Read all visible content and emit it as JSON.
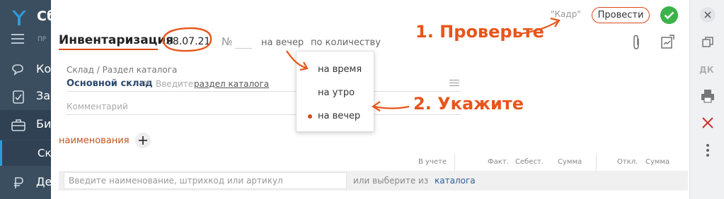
{
  "sidebar": {
    "logo_text": "Сб",
    "menu_label": "ПР",
    "items": [
      {
        "icon": "contacts-icon",
        "label": "Ко"
      },
      {
        "icon": "tasks-icon",
        "label": "За"
      },
      {
        "icon": "business-icon",
        "label": "Би"
      },
      {
        "icon": "money-icon",
        "label": "Де"
      }
    ],
    "sub_item": "Ск"
  },
  "header": {
    "title": "Инвентаризация",
    "date": "08.07.21",
    "number_label": "№",
    "time_value": "на вечер",
    "mode_value": "по количеству",
    "kadr": "\"Кадр\"",
    "provesti_label": "Провести"
  },
  "form": {
    "sklad_label": "Склад / Раздел каталога",
    "sklad_value": "Основной склад",
    "razdel_placeholder": "Введите",
    "razdel_link": "раздел каталога",
    "comment_placeholder": "Комментарий"
  },
  "tabs": {
    "naimenovaniya": "наименования"
  },
  "table": {
    "columns": [
      "В учете",
      "Факт.",
      "Себест.",
      "Сумма",
      "Откл.",
      "Сумма"
    ]
  },
  "search": {
    "placeholder": "Введите наименование, штрихкод или артикул",
    "or_text": "или выберите из",
    "catalog_link": "каталога"
  },
  "dropdown": {
    "options": [
      "на время",
      "на утро",
      "на вечер"
    ],
    "selected": "на вечер"
  },
  "right_toolbar": {
    "dk_label": "ДК"
  },
  "annotations": {
    "step1": "1. Проверьте",
    "step2": "2. Укажите"
  },
  "colors": {
    "accent": "#d84b16",
    "annotation": "#e8551a",
    "sidebar_bg": "#3b4e5f",
    "ok_green": "#3bb34a",
    "link_blue": "#2b5f9a"
  }
}
